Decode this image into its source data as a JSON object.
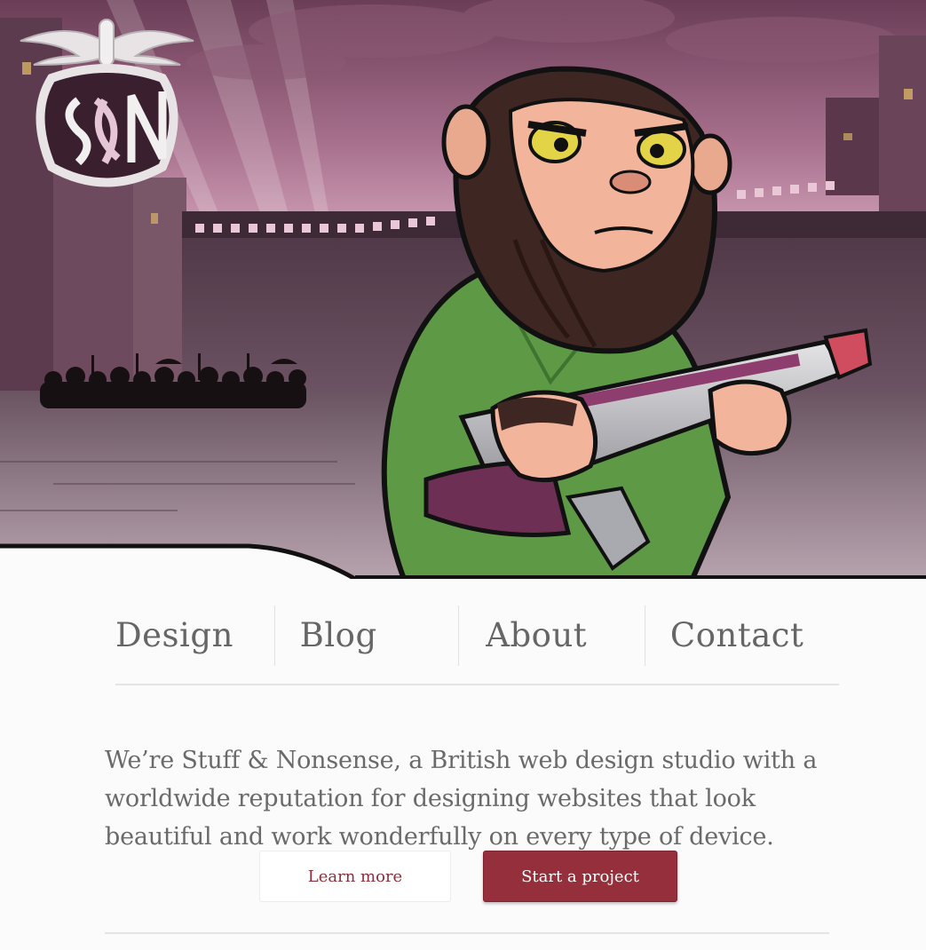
{
  "hero": {
    "logo_icon": "sn-monogram-logo",
    "colors": {
      "sky_top": "#6b3d57",
      "sky_bottom": "#d9a9c1",
      "floor": "#5a4352",
      "jacket": "#5e9a45",
      "skin": "#f2b49a",
      "fur": "#3e2622"
    }
  },
  "nav": {
    "items": [
      {
        "label": "Design"
      },
      {
        "label": "Blog"
      },
      {
        "label": "About"
      },
      {
        "label": "Contact"
      }
    ]
  },
  "intro": {
    "text": "We’re Stuff & Nonsense, a British web design studio with a worldwide reputation for designing websites that look beautiful and work wonderfully on every type of device."
  },
  "actions": {
    "learn_more": "Learn more",
    "start_project": "Start a project",
    "accent": "#962f3c"
  }
}
